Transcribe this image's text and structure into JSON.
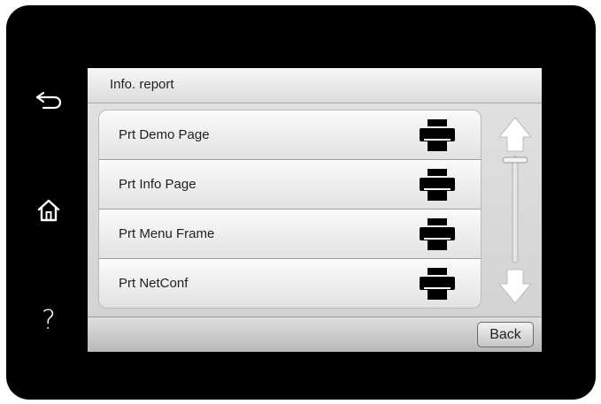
{
  "side_buttons": [
    {
      "icon": "back-arrow-icon"
    },
    {
      "icon": "home-icon"
    },
    {
      "icon": "help-icon",
      "label": "?"
    }
  ],
  "screen": {
    "title": "Info. report",
    "items": [
      {
        "label": "Prt Demo Page",
        "icon": "printer-icon"
      },
      {
        "label": "Prt Info Page",
        "icon": "printer-icon"
      },
      {
        "label": "Prt Menu Frame",
        "icon": "printer-icon"
      },
      {
        "label": "Prt NetConf",
        "icon": "printer-icon"
      }
    ],
    "scrollbar": {
      "up_icon": "arrow-up-icon",
      "down_icon": "arrow-down-icon"
    },
    "back_label": "Back"
  },
  "colors": {
    "bezel": "#000000",
    "screen_bg": "#d3d3d3",
    "text": "#222222"
  }
}
